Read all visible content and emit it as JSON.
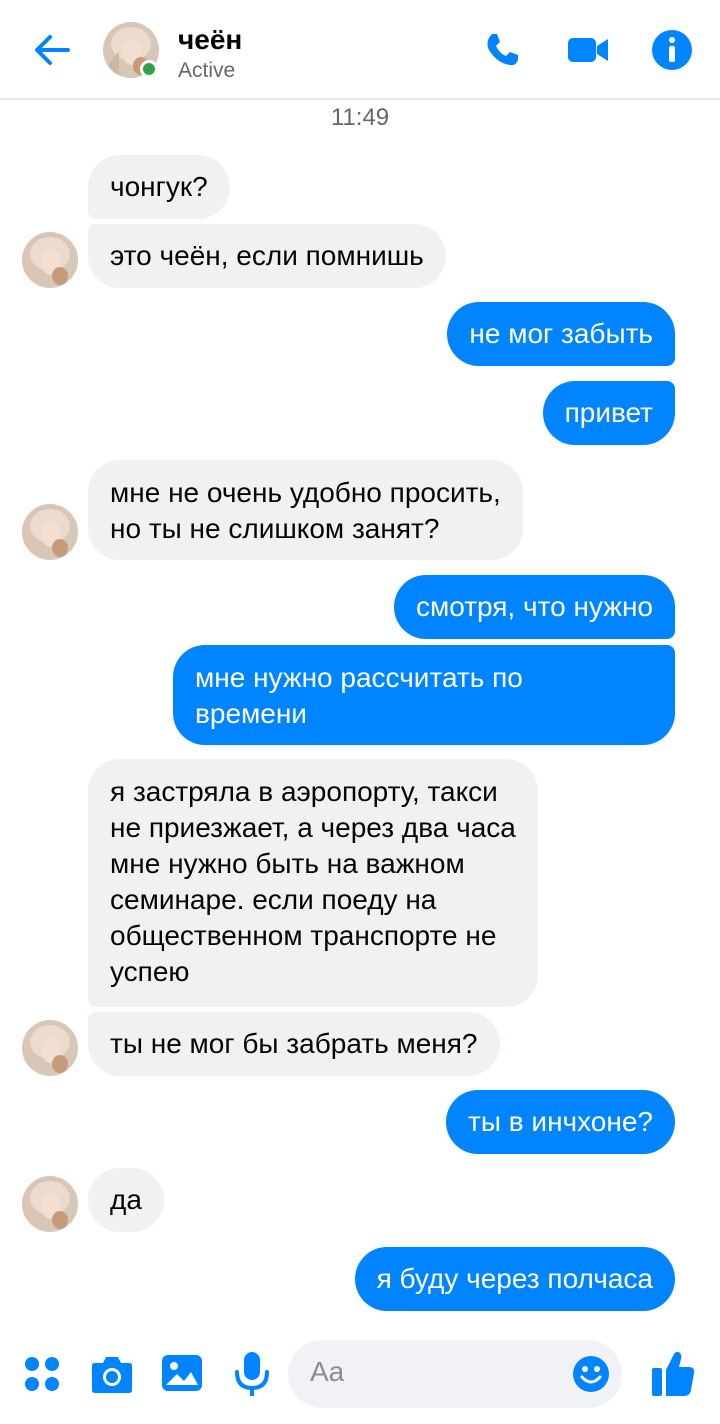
{
  "header": {
    "name": "чеён",
    "status": "Active",
    "accent": "#0084ff",
    "online_color": "#31a24c",
    "icons": [
      "back-arrow-icon",
      "phone-icon",
      "video-camera-icon",
      "info-icon"
    ]
  },
  "chat": {
    "timestamp": "11:49",
    "messages": [
      {
        "from": "them",
        "text": "чонгук?"
      },
      {
        "from": "them",
        "text": "это чеён, если помнишь"
      },
      {
        "from": "me",
        "text": "не мог забыть"
      },
      {
        "from": "me",
        "text": "привет"
      },
      {
        "from": "them",
        "lines": [
          "мне не очень удобно просить,",
          "но ты не слишком занят?"
        ]
      },
      {
        "from": "me",
        "text": "смотря, что нужно"
      },
      {
        "from": "me",
        "lines": [
          "мне нужно рассчитать по",
          "времени"
        ]
      },
      {
        "from": "them",
        "lines": [
          "я застряла в аэропорту, такси",
          "не приезжает, а через два часа",
          "мне нужно быть на важном",
          "семинаре. если поеду на",
          "общественном транспорте не",
          "успею"
        ]
      },
      {
        "from": "them",
        "text": "ты не мог бы забрать меня?"
      },
      {
        "from": "me",
        "text": "ты в инчхоне?"
      },
      {
        "from": "them",
        "text": "да"
      },
      {
        "from": "me",
        "text": "я буду через полчаса"
      }
    ]
  },
  "composer": {
    "placeholder": "Aa",
    "icons": [
      "apps-icon",
      "camera-icon",
      "gallery-icon",
      "microphone-icon",
      "emoji-icon",
      "like-thumb-icon"
    ]
  }
}
